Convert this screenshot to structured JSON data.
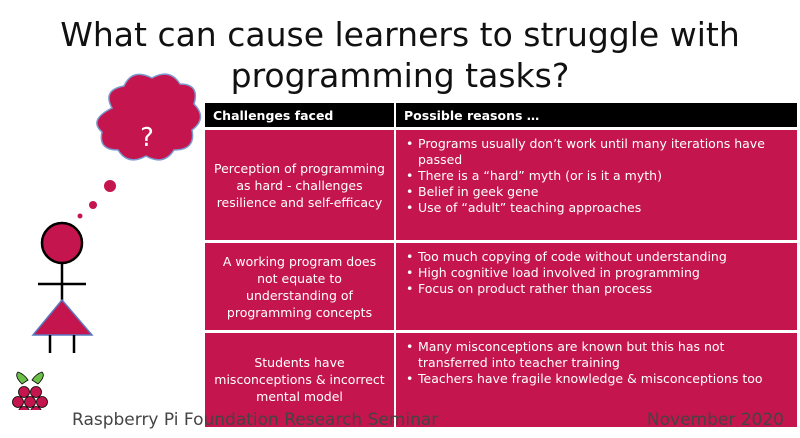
{
  "slide": {
    "title_line1": "What can cause learners to struggle with",
    "title_line2": "programming tasks?"
  },
  "thought_bubble": {
    "symbol": "?"
  },
  "table": {
    "headers": [
      "Challenges faced",
      "Possible reasons …"
    ],
    "rows": [
      {
        "challenge": "Perception of programming as hard - challenges resilience and self-efficacy",
        "reasons": [
          "Programs usually don’t work until many iterations have passed",
          "There is a “hard” myth (or is it a myth)",
          "Belief in geek gene",
          "Use of “adult” teaching approaches"
        ]
      },
      {
        "challenge": "A working program does not equate to understanding of programming concepts",
        "reasons": [
          "Too much copying of code without understanding",
          "High cognitive load involved in programming",
          "Focus on product rather than process"
        ]
      },
      {
        "challenge": "Students have misconceptions & incorrect mental model",
        "reasons": [
          "Many misconceptions are known but this has not transferred into teacher training",
          "Teachers have fragile knowledge & misconceptions too"
        ]
      }
    ]
  },
  "footer": {
    "left": "Raspberry Pi Foundation Research Seminar",
    "right": "November 2020"
  },
  "colors": {
    "accent": "#c5154e",
    "header": "#000000",
    "logo_leaf": "#6cc04a"
  }
}
